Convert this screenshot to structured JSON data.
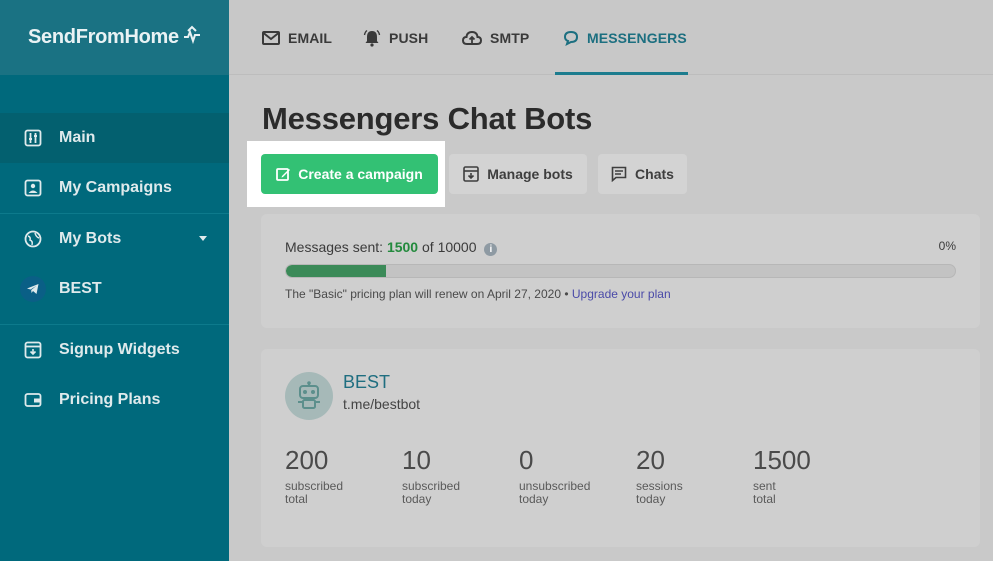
{
  "app": {
    "logo": "SendFromHome"
  },
  "sidebar": {
    "items": [
      {
        "label": "Main",
        "icon": "sliders-icon",
        "active": true
      },
      {
        "label": "My Campaigns",
        "icon": "campaigns-icon"
      },
      {
        "label": "My Bots",
        "icon": "globe-icon",
        "expandable": true
      },
      {
        "label": "BEST",
        "icon": "telegram-icon"
      },
      {
        "label": "Signup Widgets",
        "icon": "widget-icon"
      },
      {
        "label": "Pricing Plans",
        "icon": "wallet-icon"
      }
    ]
  },
  "tabs": [
    {
      "label": "EMAIL",
      "icon": "envelope-icon"
    },
    {
      "label": "PUSH",
      "icon": "bell-icon"
    },
    {
      "label": "SMTP",
      "icon": "cloud-upload-icon"
    },
    {
      "label": "MESSENGERS",
      "icon": "chat-bubble-icon",
      "active": true
    }
  ],
  "page": {
    "title": "Messengers Chat Bots",
    "actions": {
      "create": "Create a campaign",
      "manage": "Manage bots",
      "chats": "Chats"
    }
  },
  "quota": {
    "label": "Messages sent:",
    "sent": "1500",
    "of_label": "of",
    "total": "10000",
    "percent": "0%",
    "fill_fraction": 0.15,
    "renew_text": "The \"Basic\" pricing plan will renew on April 27, 2020 •",
    "upgrade_link": "Upgrade your plan"
  },
  "bot": {
    "name": "BEST",
    "handle": "t.me/bestbot",
    "stats": [
      {
        "value": "200",
        "line1": "subscribed",
        "line2": "total"
      },
      {
        "value": "10",
        "line1": "subscribed",
        "line2": "today"
      },
      {
        "value": "0",
        "line1": "unsubscribed",
        "line2": "today"
      },
      {
        "value": "20",
        "line1": "sessions",
        "line2": "today"
      },
      {
        "value": "1500",
        "line1": "sent",
        "line2": "total"
      }
    ]
  },
  "colors": {
    "sidebar": "#00697c",
    "accent_green": "#33c174",
    "active_tab": "#1c6f80",
    "link": "#4a4aa8"
  }
}
